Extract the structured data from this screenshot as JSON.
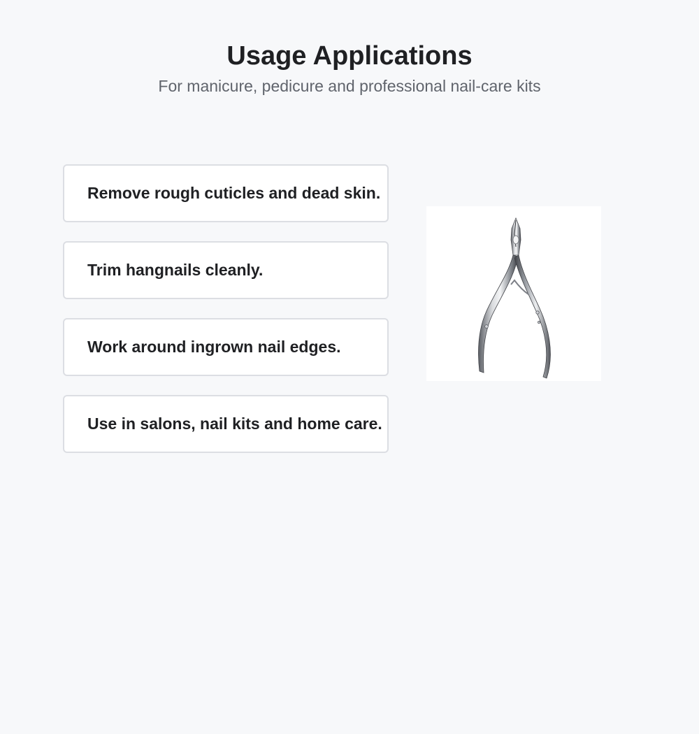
{
  "header": {
    "title": "Usage Applications",
    "subtitle": "For manicure, pedicure and professional nail-care kits"
  },
  "applications": [
    {
      "text": "Remove rough cuticles and dead skin."
    },
    {
      "text": "Trim hangnails cleanly."
    },
    {
      "text": "Work around ingrown nail edges."
    },
    {
      "text": "Use in salons, nail kits and home care."
    }
  ],
  "product_image": {
    "icon": "cuticle-nipper-icon"
  },
  "colors": {
    "background": "#f7f8fa",
    "card_border": "#dcdee3",
    "title_text": "#1f2023",
    "subtitle_text": "#60646c"
  }
}
